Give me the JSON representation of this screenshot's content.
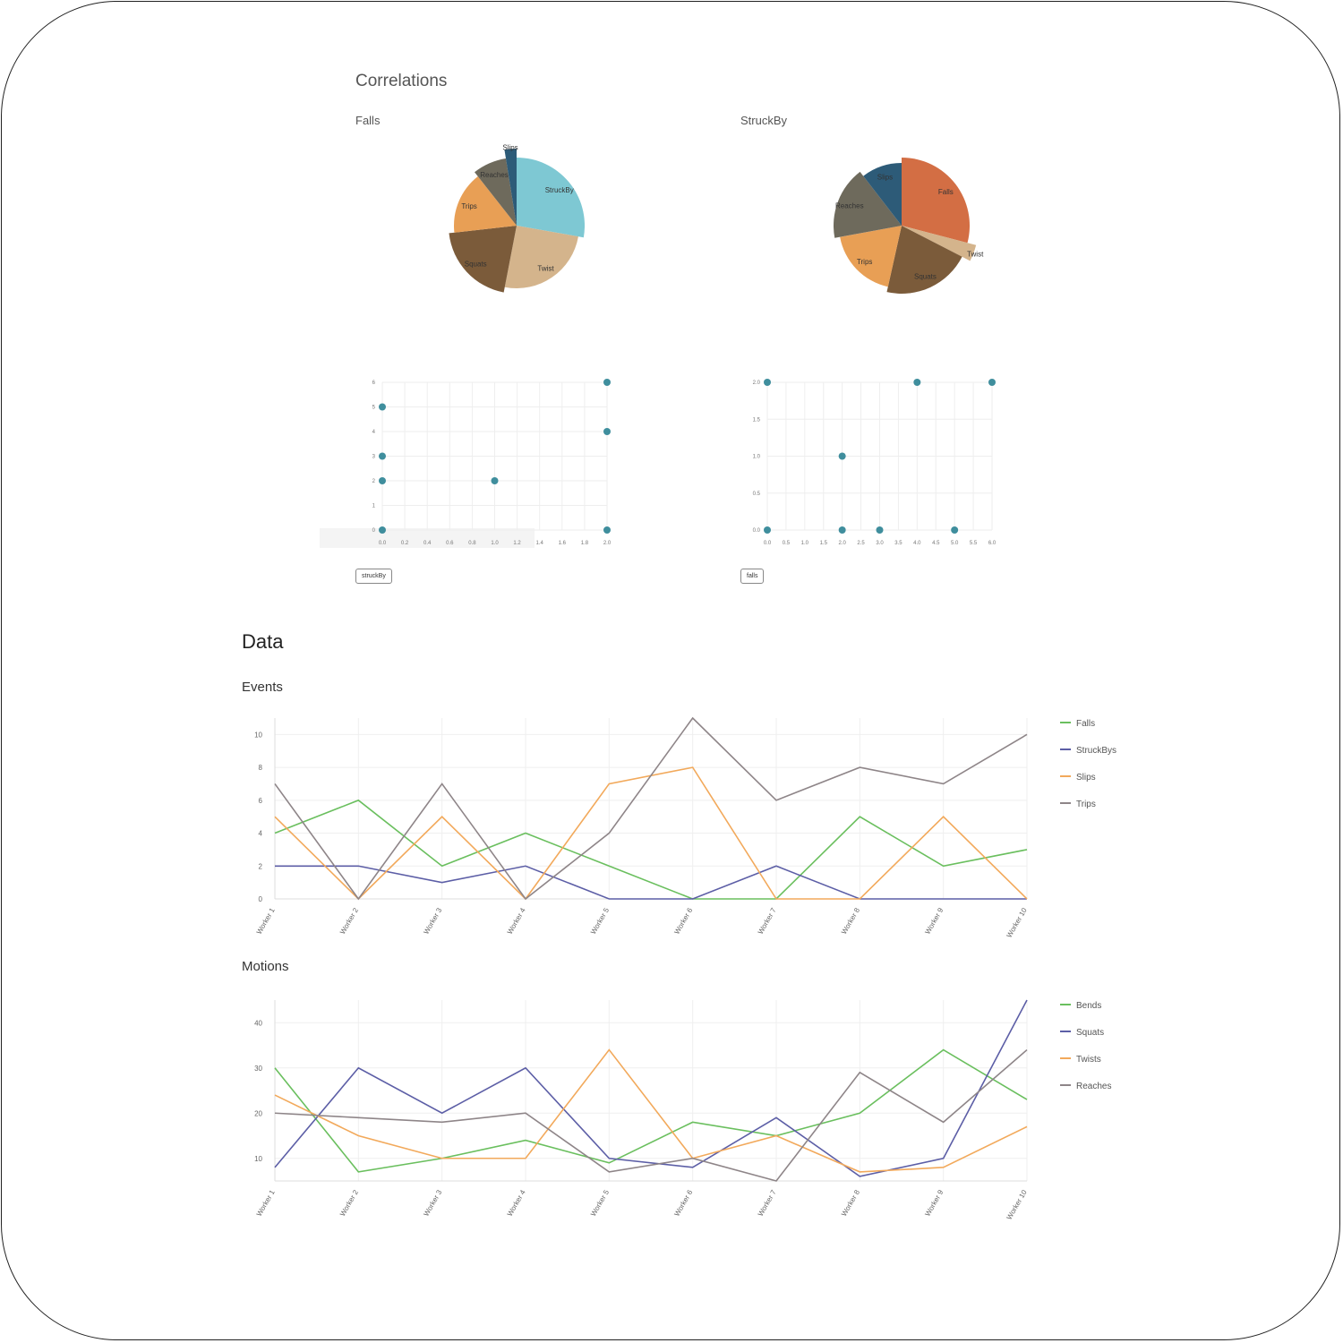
{
  "correlations": {
    "title": "Correlations",
    "pies": [
      {
        "name": "Falls",
        "slices": [
          {
            "label": "StruckBy",
            "value": 5.5,
            "color": "#7ec8d3"
          },
          {
            "label": "Twist",
            "value": 5.0,
            "color": "#d4b48c"
          },
          {
            "label": "Squats",
            "value": 4.0,
            "color": "#7b5b3a"
          },
          {
            "label": "Trips",
            "value": 3.2,
            "color": "#e89f55"
          },
          {
            "label": "Reaches",
            "value": 1.6,
            "color": "#6e6a5c"
          },
          {
            "label": "Slips",
            "value": 0.5,
            "color": "#2d5b78"
          }
        ]
      },
      {
        "name": "StruckBy",
        "slices": [
          {
            "label": "Falls",
            "value": 5.0,
            "color": "#d36e44"
          },
          {
            "label": "Twist",
            "value": 0.6,
            "color": "#d4b48c"
          },
          {
            "label": "Squats",
            "value": 3.6,
            "color": "#7b5b3a"
          },
          {
            "label": "Trips",
            "value": 3.2,
            "color": "#e89f55"
          },
          {
            "label": "Reaches",
            "value": 3.0,
            "color": "#6e6a5c"
          },
          {
            "label": "Slips",
            "value": 1.8,
            "color": "#2d5b78"
          }
        ]
      }
    ],
    "scatters": [
      {
        "button": "struckBy",
        "x_ticks": [
          "0.0",
          "0.2",
          "0.4",
          "0.6",
          "0.8",
          "1.0",
          "1.2",
          "1.4",
          "1.6",
          "1.8",
          "2.0"
        ],
        "y_ticks": [
          "0",
          "1",
          "2",
          "3",
          "4",
          "5",
          "6"
        ],
        "xlim": [
          0,
          2
        ],
        "ylim": [
          0,
          6
        ],
        "points": [
          [
            0,
            5
          ],
          [
            0,
            3
          ],
          [
            0,
            2
          ],
          [
            0,
            0
          ],
          [
            1,
            2
          ],
          [
            2,
            6
          ],
          [
            2,
            4
          ],
          [
            2,
            0
          ]
        ]
      },
      {
        "button": "falls",
        "x_ticks": [
          "0.0",
          "0.5",
          "1.0",
          "1.5",
          "2.0",
          "2.5",
          "3.0",
          "3.5",
          "4.0",
          "4.5",
          "5.0",
          "5.5",
          "6.0"
        ],
        "y_ticks": [
          "0.0",
          "0.5",
          "1.0",
          "1.5",
          "2.0"
        ],
        "xlim": [
          0,
          6
        ],
        "ylim": [
          0,
          2
        ],
        "points": [
          [
            0,
            2
          ],
          [
            0,
            0
          ],
          [
            2,
            1
          ],
          [
            2,
            0
          ],
          [
            3,
            0
          ],
          [
            4,
            2
          ],
          [
            5,
            0
          ],
          [
            6,
            2
          ]
        ]
      }
    ]
  },
  "data_section": {
    "title": "Data",
    "events": {
      "title": "Events",
      "chart_data": {
        "type": "line",
        "categories": [
          "Worker 1",
          "Worker 2",
          "Worker 3",
          "Worker 4",
          "Worker 5",
          "Worker 6",
          "Worker 7",
          "Worker 8",
          "Worker 9",
          "Worker 10"
        ],
        "y_ticks": [
          "0",
          "2",
          "4",
          "6",
          "8",
          "10"
        ],
        "ylim": [
          0,
          11
        ],
        "series": [
          {
            "name": "Falls",
            "color": "#6abf5e",
            "values": [
              4,
              6,
              2,
              4,
              2,
              0,
              0,
              5,
              2,
              3
            ]
          },
          {
            "name": "StruckBys",
            "color": "#5c5ea6",
            "values": [
              2,
              2,
              1,
              2,
              0,
              0,
              2,
              0,
              0,
              0
            ]
          },
          {
            "name": "Slips",
            "color": "#f2a95b",
            "values": [
              5,
              0,
              5,
              0,
              7,
              8,
              0,
              0,
              5,
              0
            ]
          },
          {
            "name": "Trips",
            "color": "#8e8588",
            "values": [
              7,
              0,
              7,
              0,
              4,
              11,
              6,
              8,
              7,
              10
            ]
          }
        ]
      }
    },
    "motions": {
      "title": "Motions",
      "chart_data": {
        "type": "line",
        "categories": [
          "Worker 1",
          "Worker 2",
          "Worker 3",
          "Worker 4",
          "Worker 5",
          "Worker 6",
          "Worker 7",
          "Worker 8",
          "Worker 9",
          "Worker 10"
        ],
        "y_ticks": [
          "10",
          "20",
          "30",
          "40"
        ],
        "ylim": [
          5,
          45
        ],
        "series": [
          {
            "name": "Bends",
            "color": "#6abf5e",
            "values": [
              30,
              7,
              10,
              14,
              9,
              18,
              15,
              20,
              34,
              23
            ]
          },
          {
            "name": "Squats",
            "color": "#5c5ea6",
            "values": [
              8,
              30,
              20,
              30,
              10,
              8,
              19,
              6,
              10,
              45
            ]
          },
          {
            "name": "Twists",
            "color": "#f2a95b",
            "values": [
              24,
              15,
              10,
              10,
              34,
              10,
              15,
              7,
              8,
              17
            ]
          },
          {
            "name": "Reaches",
            "color": "#8e8588",
            "values": [
              20,
              19,
              18,
              20,
              7,
              10,
              5,
              29,
              18,
              34
            ]
          }
        ]
      }
    }
  }
}
